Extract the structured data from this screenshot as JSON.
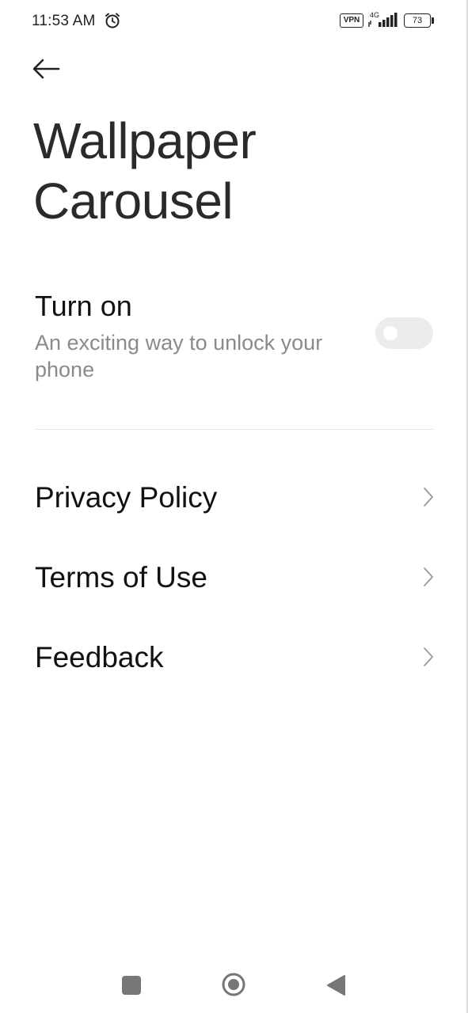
{
  "status_bar": {
    "time": "11:53 AM",
    "vpn": "VPN",
    "network": "4G",
    "battery": "73",
    "icons": [
      "alarm-icon",
      "vpn-badge",
      "signal-icon",
      "battery-icon"
    ]
  },
  "header": {
    "back_icon": "arrow-left-icon",
    "title": "Wallpaper Carousel"
  },
  "turn_on": {
    "title": "Turn on",
    "description": "An exciting way to unlock your phone",
    "toggle_on": false
  },
  "list": {
    "items": [
      {
        "label": "Privacy Policy",
        "icon": "chevron-right-icon"
      },
      {
        "label": "Terms of Use",
        "icon": "chevron-right-icon"
      },
      {
        "label": "Feedback",
        "icon": "chevron-right-icon"
      }
    ]
  },
  "nav_bar": {
    "icons": [
      "recents-square-icon",
      "home-circle-icon",
      "back-triangle-icon"
    ]
  },
  "colors": {
    "background": "#ffffff",
    "primary_text": "#111111",
    "secondary_text": "#8a8a8a",
    "toggle_track": "#ececec",
    "divider": "#e4e4e4"
  }
}
